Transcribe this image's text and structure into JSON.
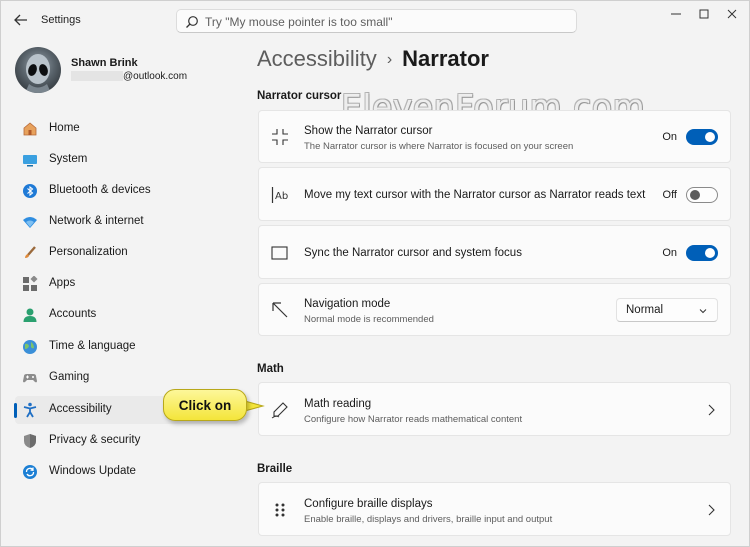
{
  "window": {
    "app_title": "Settings",
    "search_placeholder": "Try \"My mouse pointer is too small\""
  },
  "profile": {
    "name": "Shawn Brink",
    "email_suffix": "@outlook.com"
  },
  "sidebar": {
    "items": [
      {
        "label": "Home",
        "icon": "home-icon"
      },
      {
        "label": "System",
        "icon": "system-icon"
      },
      {
        "label": "Bluetooth & devices",
        "icon": "bluetooth-icon"
      },
      {
        "label": "Network & internet",
        "icon": "network-icon"
      },
      {
        "label": "Personalization",
        "icon": "brush-icon"
      },
      {
        "label": "Apps",
        "icon": "apps-icon"
      },
      {
        "label": "Accounts",
        "icon": "accounts-icon"
      },
      {
        "label": "Time & language",
        "icon": "globe-icon"
      },
      {
        "label": "Gaming",
        "icon": "gamepad-icon"
      },
      {
        "label": "Accessibility",
        "icon": "accessibility-icon",
        "selected": true
      },
      {
        "label": "Privacy & security",
        "icon": "shield-icon"
      },
      {
        "label": "Windows Update",
        "icon": "update-icon"
      }
    ]
  },
  "breadcrumb": {
    "parent": "Accessibility",
    "separator": "›",
    "current": "Narrator"
  },
  "sections": {
    "narrator_cursor": "Narrator cursor",
    "math": "Math",
    "braille": "Braille"
  },
  "settings": {
    "show_cursor": {
      "title": "Show the Narrator cursor",
      "description": "The Narrator cursor is where Narrator is focused on your screen",
      "state": "On",
      "on": true
    },
    "move_text_cursor": {
      "title": "Move my text cursor with the Narrator cursor as Narrator reads text",
      "state": "Off",
      "on": false
    },
    "sync_focus": {
      "title": "Sync the Narrator cursor and system focus",
      "state": "On",
      "on": true
    },
    "navigation_mode": {
      "title": "Navigation mode",
      "description": "Normal mode is recommended",
      "value": "Normal"
    },
    "math_reading": {
      "title": "Math reading",
      "description": "Configure how Narrator reads mathematical content"
    },
    "braille_displays": {
      "title": "Configure braille displays",
      "description": "Enable braille, displays and drivers, braille input and output"
    }
  },
  "callout": {
    "text": "Click on"
  },
  "watermark": "ElevenForum.com",
  "colors": {
    "accent": "#005fb8",
    "callout": "#f7e84a"
  }
}
